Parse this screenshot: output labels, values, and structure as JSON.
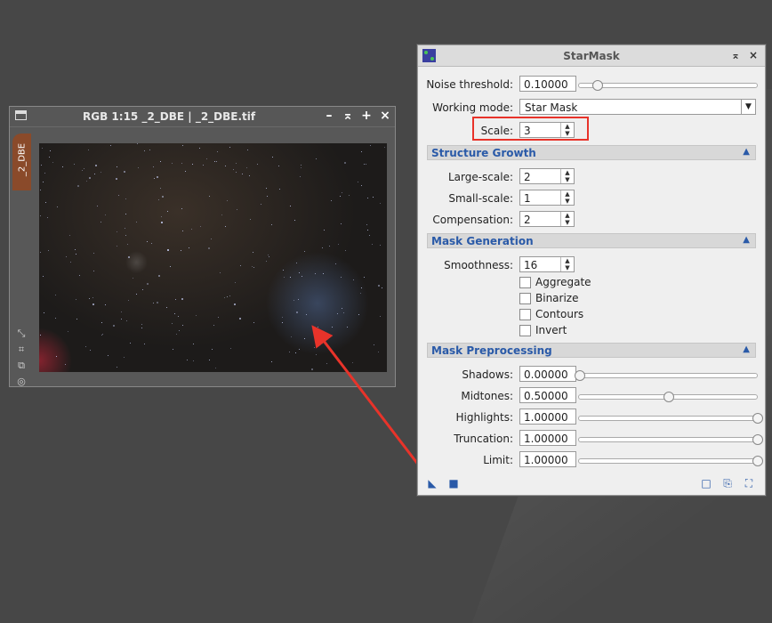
{
  "image_window": {
    "title": "RGB 1:15 _2_DBE | _2_DBE.tif",
    "vertical_tab": "_2_DBE",
    "controls": [
      "minimize-icon",
      "shade-icon",
      "maximize-icon",
      "close-icon"
    ]
  },
  "starmask": {
    "title": "StarMask",
    "noise_threshold": {
      "label": "Noise threshold:",
      "value": "0.10000",
      "slider": 0.1
    },
    "working_mode": {
      "label": "Working mode:",
      "value": "Star Mask"
    },
    "scale": {
      "label": "Scale:",
      "value": "3"
    },
    "sections": {
      "structure_growth": {
        "title": "Structure Growth",
        "large_scale": {
          "label": "Large-scale:",
          "value": "2"
        },
        "small_scale": {
          "label": "Small-scale:",
          "value": "1"
        },
        "compensation": {
          "label": "Compensation:",
          "value": "2"
        }
      },
      "mask_generation": {
        "title": "Mask Generation",
        "smoothness": {
          "label": "Smoothness:",
          "value": "16"
        },
        "checkboxes": [
          {
            "label": "Aggregate",
            "checked": false
          },
          {
            "label": "Binarize",
            "checked": false
          },
          {
            "label": "Contours",
            "checked": false
          },
          {
            "label": "Invert",
            "checked": false
          }
        ]
      },
      "mask_preprocessing": {
        "title": "Mask Preprocessing",
        "shadows": {
          "label": "Shadows:",
          "value": "0.00000",
          "slider": 0.0
        },
        "midtones": {
          "label": "Midtones:",
          "value": "0.50000",
          "slider": 0.5
        },
        "highlights": {
          "label": "Highlights:",
          "value": "1.00000",
          "slider": 1.0
        },
        "truncation": {
          "label": "Truncation:",
          "value": "1.00000",
          "slider": 1.0
        },
        "limit": {
          "label": "Limit:",
          "value": "1.00000",
          "slider": 1.0
        }
      }
    }
  },
  "colors": {
    "highlight": "#e8332a",
    "accent": "#2a5aa8",
    "tab": "#8a4a2a"
  }
}
